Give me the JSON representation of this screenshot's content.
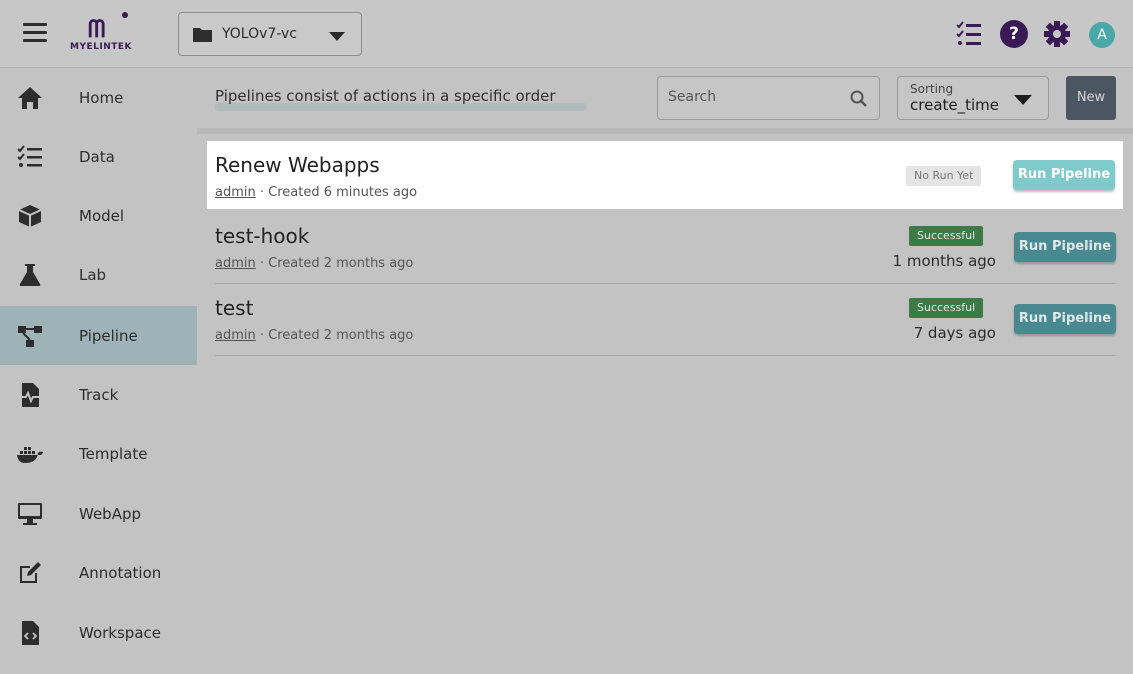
{
  "header": {
    "logo_text": "MYELINTEK",
    "project_name": "YOLOv7-vc",
    "help_glyph": "?",
    "avatar_initial": "A",
    "icons": [
      "menu-icon",
      "folder-icon",
      "tasks-icon",
      "help-icon",
      "gear-icon"
    ]
  },
  "sidebar": {
    "items": [
      {
        "label": "Home",
        "icon": "home-icon"
      },
      {
        "label": "Data",
        "icon": "checklist-icon"
      },
      {
        "label": "Model",
        "icon": "cube-icon"
      },
      {
        "label": "Lab",
        "icon": "flask-icon"
      },
      {
        "label": "Pipeline",
        "icon": "pipeline-icon",
        "active": true
      },
      {
        "label": "Track",
        "icon": "track-icon"
      },
      {
        "label": "Template",
        "icon": "docker-icon"
      },
      {
        "label": "WebApp",
        "icon": "monitor-icon"
      },
      {
        "label": "Annotation",
        "icon": "edit-icon"
      },
      {
        "label": "Workspace",
        "icon": "code-file-icon"
      }
    ]
  },
  "toolbar": {
    "hint": "Pipelines consist of actions in a specific order",
    "search_placeholder": "Search",
    "sorting_label": "Sorting",
    "sorting_value": "create_time",
    "new_label": "New"
  },
  "pipelines": [
    {
      "name": "Renew Webapps",
      "user": "admin",
      "created": " · Created 6 minutes ago",
      "status": "No Run Yet",
      "last_run": "",
      "run_label": "Run Pipeline"
    },
    {
      "name": "test-hook",
      "user": "admin",
      "created": " · Created 2 months ago",
      "status": "Successful",
      "last_run": "1 months ago",
      "run_label": "Run Pipeline"
    },
    {
      "name": "test",
      "user": "admin",
      "created": " · Created 2 months ago",
      "status": "Successful",
      "last_run": "7 days ago",
      "run_label": "Run Pipeline"
    }
  ],
  "colors": {
    "brand": "#3a1a55",
    "active_nav": "#9db3b8",
    "success": "#3d7a45",
    "run_button": "#488a90",
    "run_button_light": "#7fcbcc",
    "new_button": "#4c5663"
  }
}
